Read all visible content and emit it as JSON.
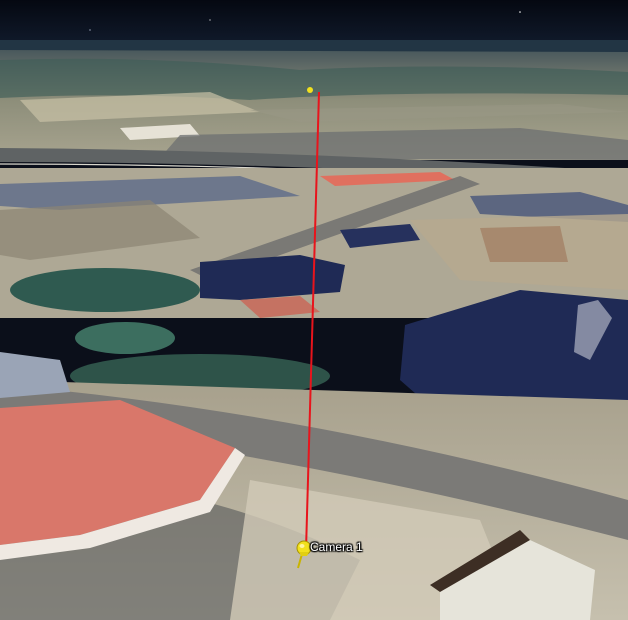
{
  "placemark": {
    "label": "Camera 1",
    "icon": "yellow-pushpin-icon",
    "pin_color": "#f2e11d",
    "line_color": "#e8141c"
  },
  "colors": {
    "sky": "#0b0f1a",
    "horizon": "#2b3a4a",
    "ground": "#b9b19a",
    "roof_red": "#d9776a",
    "shadow": "#1f2a55",
    "trees": "#2f5a50",
    "road": "#6f6f70"
  }
}
